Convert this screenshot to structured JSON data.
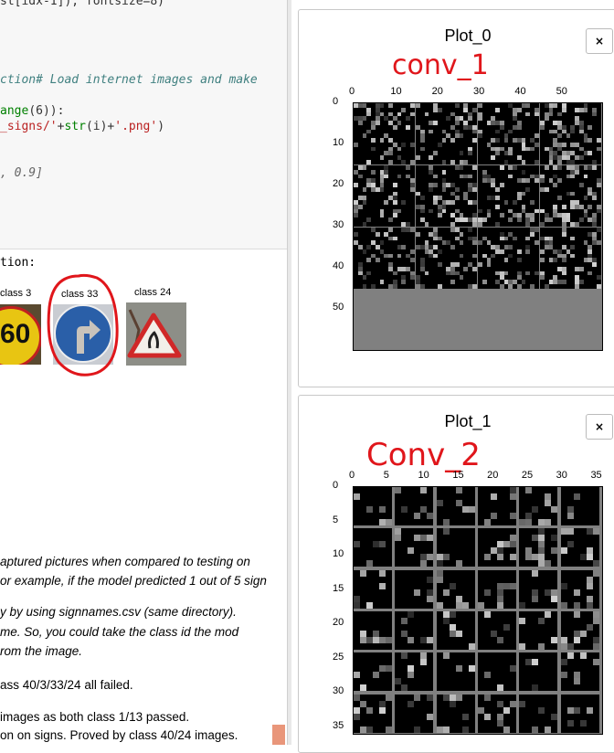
{
  "notebook": {
    "code_lines": [
      {
        "pre": "st[idx-1]), fontsize=8)",
        "kind": "plain"
      },
      {
        "comment": "ction# Load internet images and make ",
        "kind": "comment"
      },
      {
        "pre": "",
        "fn": "ange",
        "post": "(6)):",
        "kind": "range"
      },
      {
        "str1": "_signs/'",
        "mid": "+",
        "bi": "str",
        "mid2": "(i)+",
        "str2": "'.png'",
        "post": ")",
        "kind": "path"
      },
      {
        "pre": ", 0.9]",
        "kind": "num"
      }
    ],
    "output_label": "tion:",
    "classes": [
      {
        "label": "class 3"
      },
      {
        "label": "class 33"
      },
      {
        "label": "class 24"
      }
    ],
    "sign_speed_text": "60",
    "markdown": [
      "aptured pictures when compared to testing on",
      "or example, if the model predicted 1 out of 5 sign",
      "y by using signnames.csv (same directory). ",
      "me. So, you could take the class id the mod",
      "rom the image.",
      "ass 40/3/33/24 all failed.",
      "images as both class 1/13 passed.",
      "on on signs. Proved by class 40/24 images."
    ]
  },
  "plots": [
    {
      "title": "Plot_0",
      "annotation": "conv_1",
      "close_label": "×",
      "x_ticks": [
        "0",
        "10",
        "20",
        "30",
        "40",
        "50"
      ],
      "y_ticks": [
        "0",
        "10",
        "20",
        "30",
        "40",
        "50"
      ]
    },
    {
      "title": "Plot_1",
      "annotation": "Conv_2",
      "close_label": "×",
      "x_ticks": [
        "0",
        "5",
        "10",
        "15",
        "20",
        "25",
        "30",
        "35"
      ],
      "y_ticks": [
        "0",
        "5",
        "10",
        "15",
        "20",
        "25",
        "30",
        "35"
      ]
    }
  ],
  "colors": {
    "annotation_red": "#e0161b",
    "grid_gray": "#808080"
  }
}
